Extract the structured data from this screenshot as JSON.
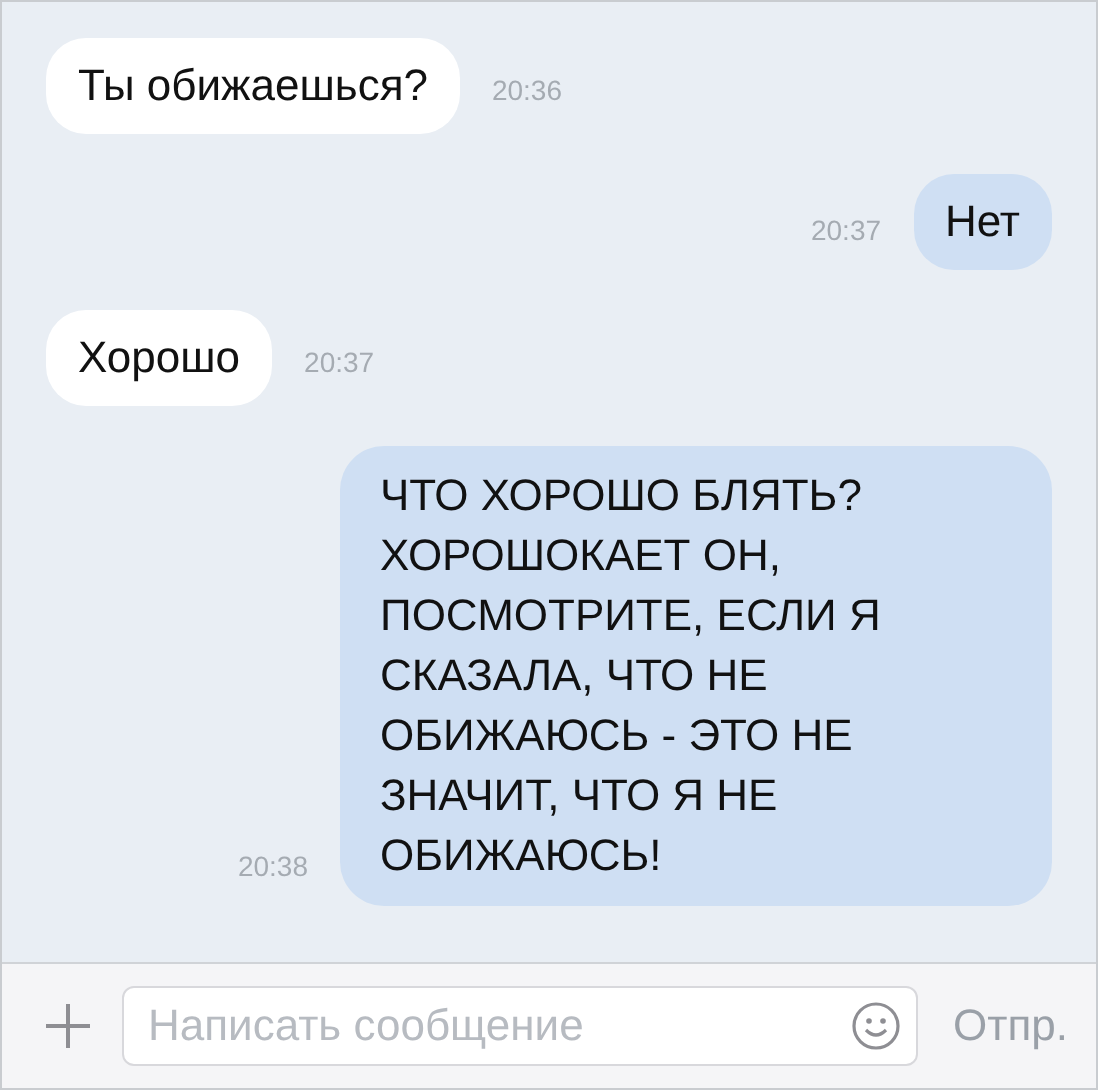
{
  "messages": [
    {
      "kind": "in",
      "text": "Ты обижаешься?",
      "time": "20:36"
    },
    {
      "kind": "out",
      "text": "Нет",
      "time": "20:37"
    },
    {
      "kind": "in",
      "text": "Хорошо",
      "time": "20:37"
    },
    {
      "kind": "out",
      "text": "ЧТО ХОРОШО БЛЯТЬ? ХОРОШОКАЕТ ОН, ПОСМОТРИТЕ, ЕСЛИ Я СКАЗАЛА, ЧТО НЕ ОБИЖАЮСЬ - ЭТО НЕ ЗНАЧИТ, ЧТО Я НЕ ОБИЖАЮСЬ!",
      "time": "20:38"
    }
  ],
  "composer": {
    "placeholder": "Написать сообщение",
    "send_label": "Отпр."
  }
}
